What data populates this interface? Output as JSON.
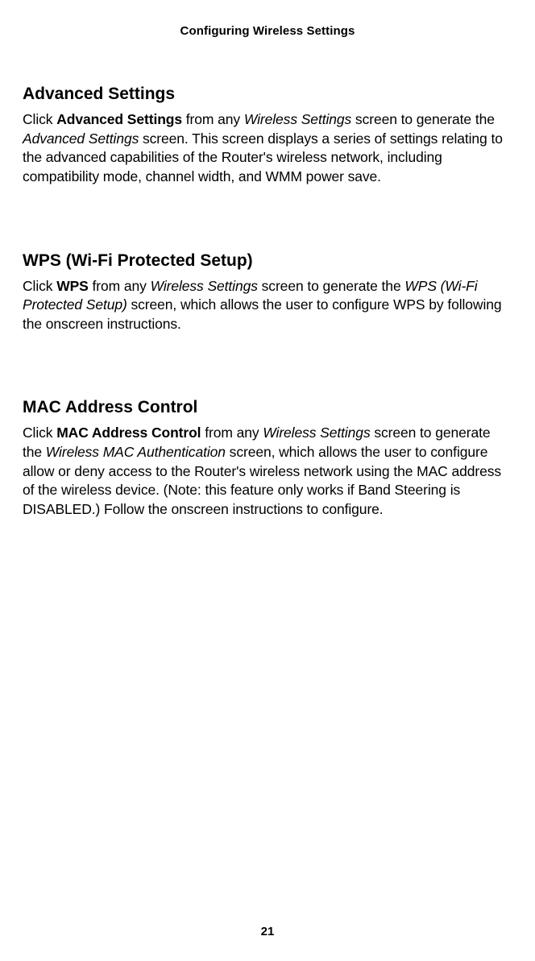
{
  "header": "Configuring Wireless Settings",
  "section1": {
    "heading": "Advanced Settings",
    "p_t1": "Click ",
    "p_b1": "Advanced Settings",
    "p_t2": " from any ",
    "p_i1": "Wireless Settings",
    "p_t3": " screen to generate the ",
    "p_i2": "Advanced Settings",
    "p_t4": " screen. This screen displays a series of settings relating to the advanced capabilities of the Router's wireless network, including compatibility mode, channel width, and WMM power save."
  },
  "section2": {
    "heading": "WPS (Wi-Fi Protected Setup)",
    "p_t1": "Click ",
    "p_b1": "WPS",
    "p_t2": " from any ",
    "p_i1": "Wireless Settings",
    "p_t3": " screen to generate the ",
    "p_i2": "WPS (Wi-Fi Protected Setup)",
    "p_t4": " screen, which allows the user to configure WPS by following the onscreen instructions."
  },
  "section3": {
    "heading": "MAC Address Control",
    "p_t1": "Click ",
    "p_b1": "MAC Address Control",
    "p_t2": " from any ",
    "p_i1": "Wireless Settings",
    "p_t3": " screen to generate the ",
    "p_i2": "Wireless MAC Authentication",
    "p_t4": " screen, which allows the user to configure allow or deny access to the Router's wireless network using the MAC address of the wireless device. (Note: this feature only works if Band Steering is DISABLED.) Follow the onscreen instructions to configure."
  },
  "page_number": "21"
}
